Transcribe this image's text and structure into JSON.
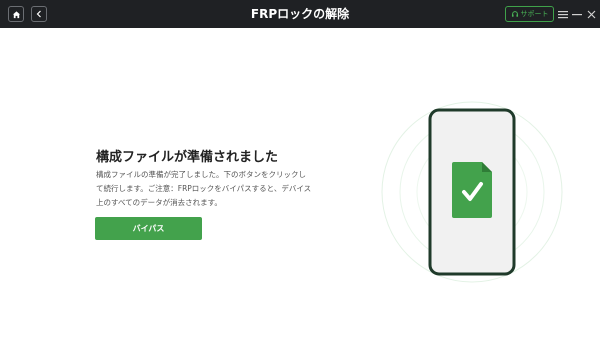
{
  "titlebar": {
    "title": "FRPロックの解除",
    "support_label": "サポート",
    "icons": [
      "home-icon",
      "back-icon",
      "headset-icon",
      "menu-icon",
      "minimize-icon",
      "close-icon"
    ]
  },
  "main": {
    "heading": "構成ファイルが準備されました",
    "description": "構成ファイルの準備が完了しました。下のボタンをクリックして続行します。ご注意：FRPロックをバイパスすると、デバイス上のすべてのデータが消去されます。",
    "primary_button": "バイパス"
  },
  "illustration": {
    "icon": "file-check-icon"
  },
  "colors": {
    "titlebar_bg": "#1f2124",
    "accent_green": "#43a24c",
    "phone_frame": "#1f3a2a"
  }
}
